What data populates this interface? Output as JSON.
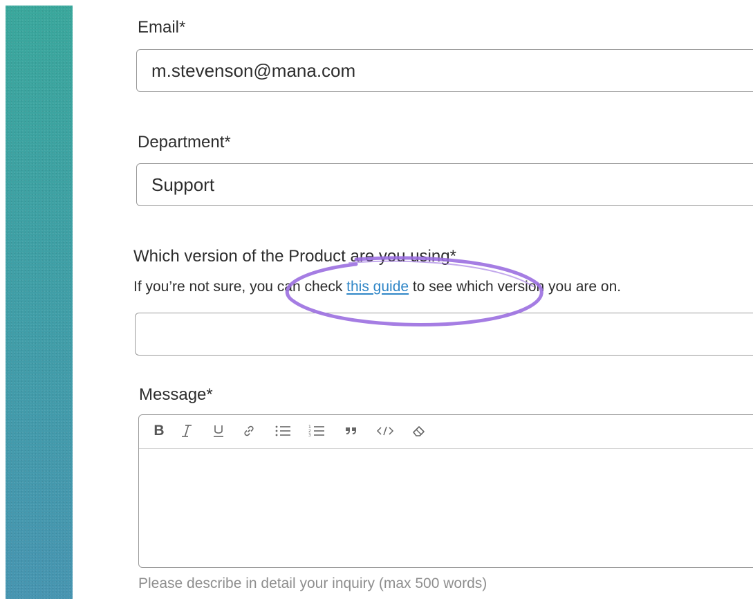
{
  "form": {
    "email": {
      "label": "Email*",
      "value": "m.stevenson@mana.com"
    },
    "department": {
      "label": "Department*",
      "value": "Support"
    },
    "version": {
      "label": "Which version of the Product are you using*",
      "help_before": "If you’re not sure, you can check ",
      "help_link": "this guide",
      "help_after": " to see which version you are on.",
      "value": ""
    },
    "message": {
      "label": "Message*",
      "value": "",
      "hint": "Please describe in detail your inquiry (max 500 words)",
      "toolbar": [
        {
          "name": "bold-button",
          "icon": "bold-icon"
        },
        {
          "name": "italic-button",
          "icon": "italic-icon"
        },
        {
          "name": "underline-button",
          "icon": "underline-icon"
        },
        {
          "name": "link-button",
          "icon": "link-icon"
        },
        {
          "name": "bullet-list-button",
          "icon": "bullet-list-icon"
        },
        {
          "name": "numbered-list-button",
          "icon": "numbered-list-icon"
        },
        {
          "name": "quote-button",
          "icon": "quote-icon"
        },
        {
          "name": "code-button",
          "icon": "code-icon"
        },
        {
          "name": "clear-format-button",
          "icon": "eraser-icon"
        }
      ]
    }
  },
  "colors": {
    "link": "#2f86c7",
    "annotation": "#9b6fe0",
    "side_strip_top": "#3aa79c",
    "side_strip_bottom": "#4795b1"
  }
}
